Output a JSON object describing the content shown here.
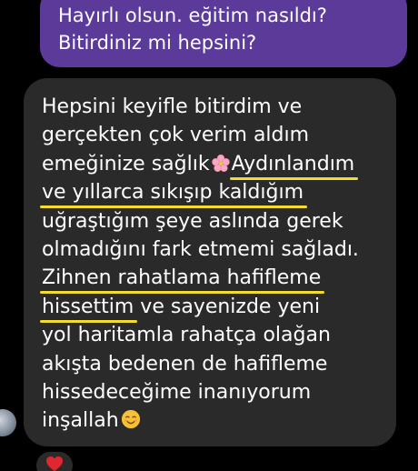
{
  "outgoing_message": {
    "lines": [
      "Hayırlı olsun. eğitim nasıldı?",
      "Bitirdiniz mi hepsini?"
    ]
  },
  "incoming_message": {
    "line1": "Hepsini keyifle bitirdim ve",
    "line2": "gerçekten çok verim aldım",
    "line3a": "emeğinize sağlık",
    "line3b": "Aydınlandım",
    "line4": "ve yıllarca sıkışıp kaldığım",
    "line5": "uğraştığım şeye aslında gerek",
    "line6": "olmadığını fark etmemi sağladı.",
    "line7": "Zihnen rahatlama hafifleme",
    "line8a": "hissettim",
    "line8b": " ve sayenizde yeni",
    "line9": "yol haritamla rahatça olağan",
    "line10": "akışta bedenen de hafifleme",
    "line11": "hissedeceğime inanıyorum",
    "line12": "inşallah"
  },
  "icons": {
    "inline_flower": "cherry-blossom-icon",
    "inline_smile": "smiling-face-icon",
    "reaction": "heart-icon"
  },
  "colors": {
    "background": "#000000",
    "outgoing_bubble": "#5b3a9a",
    "incoming_bubble": "#2a2a2a",
    "highlight_underline": "#f4dc2a",
    "reaction_heart": "#e0262f"
  }
}
